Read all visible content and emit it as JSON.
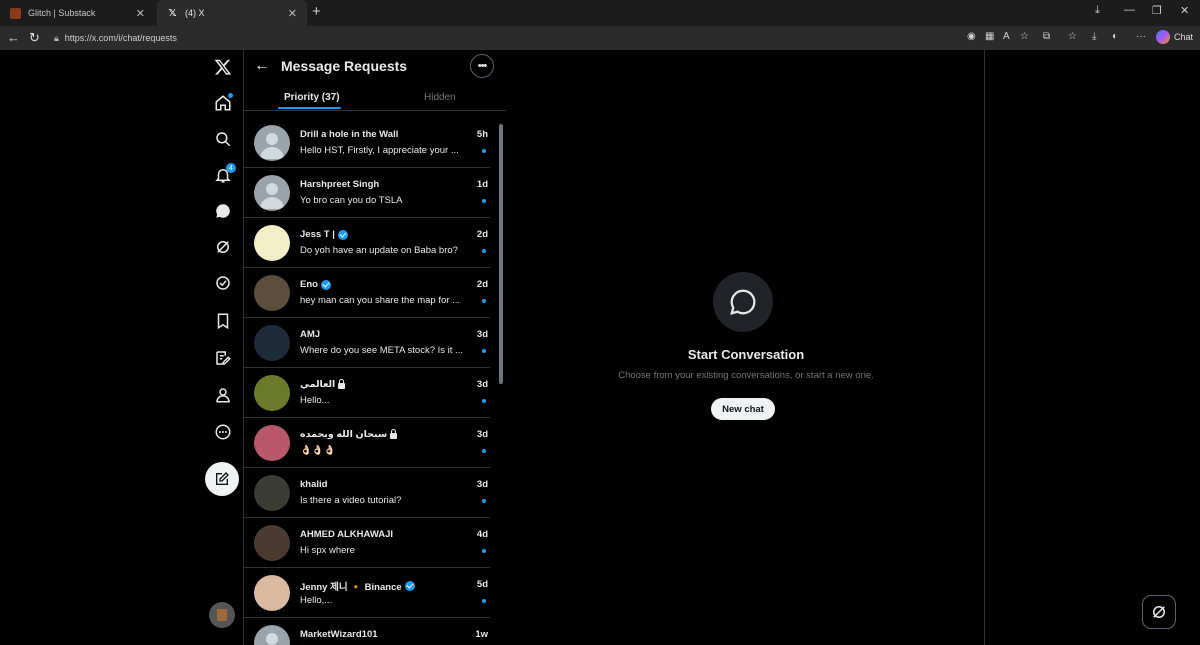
{
  "browser": {
    "tabs": [
      {
        "title": "Glitch | Substack",
        "favicon": "substack-icon"
      },
      {
        "title": "(4) X",
        "favicon": "x-logo-icon"
      }
    ],
    "url": "https://x.com/i/chat/requests",
    "chat_label": "Chat"
  },
  "nav": {
    "notifications_badge": "4",
    "icons": [
      "x-logo-icon",
      "home-icon",
      "search-icon",
      "bell-icon",
      "chat-icon",
      "grok-icon",
      "verified-icon",
      "bookmark-icon",
      "note-icon",
      "profile-icon",
      "more-icon",
      "compose-icon"
    ]
  },
  "list": {
    "title": "Message Requests",
    "tab_priority": "Priority (37)",
    "tab_hidden": "Hidden",
    "conversations": [
      {
        "name": "Drill a hole in the Wall",
        "time": "5h",
        "message": "Hello HST, Firstly, I appreciate your ...",
        "verified": false,
        "locked": false,
        "avatar": "#9aa4ad"
      },
      {
        "name": "Harshpreet Singh",
        "time": "1d",
        "message": "Yo bro can you do TSLA",
        "verified": false,
        "locked": false,
        "avatar": "#9aa4ad"
      },
      {
        "name": "Jess T |",
        "time": "2d",
        "message": "Do yoh have an update on Baba bro?",
        "verified": true,
        "locked": false,
        "avatar": "#f4efc8"
      },
      {
        "name": "Eno",
        "time": "2d",
        "message": "hey man can you share the map for ...",
        "verified": true,
        "locked": false,
        "avatar": "#5b4f3c"
      },
      {
        "name": "AMJ",
        "time": "3d",
        "message": "Where do you see META stock? Is it ...",
        "verified": false,
        "locked": false,
        "avatar": "#1f2a3a"
      },
      {
        "name": "العالمي",
        "time": "3d",
        "message": "Hello...",
        "verified": false,
        "locked": true,
        "avatar": "#6b7a2a"
      },
      {
        "name": "سبحان الله وبحمده",
        "time": "3d",
        "message": "👌🏻👌🏻👌🏻",
        "verified": false,
        "locked": true,
        "avatar": "#b8586a"
      },
      {
        "name": "khalid",
        "time": "3d",
        "message": "Is there a video tutorial?",
        "verified": false,
        "locked": false,
        "avatar": "#3a3c33"
      },
      {
        "name": "AHMED ALKHAWAJI",
        "time": "4d",
        "message": "Hi spx where",
        "verified": false,
        "locked": false,
        "avatar": "#4a3a32"
      },
      {
        "name": "Jenny 제니 🔸 Binance",
        "time": "5d",
        "message": "Hello,...",
        "verified": true,
        "locked": false,
        "avatar": "#d9b9a0"
      },
      {
        "name": "MarketWizard101",
        "time": "1w",
        "message": "",
        "verified": false,
        "locked": false,
        "avatar": "#9aa4ad"
      }
    ]
  },
  "detail": {
    "heading": "Start Conversation",
    "subtext": "Choose from your existing conversations, or start a new one.",
    "button": "New chat"
  },
  "colors": {
    "accent": "#1d9bf0",
    "background": "#000000",
    "border": "#2f3336",
    "muted": "#71767b"
  }
}
